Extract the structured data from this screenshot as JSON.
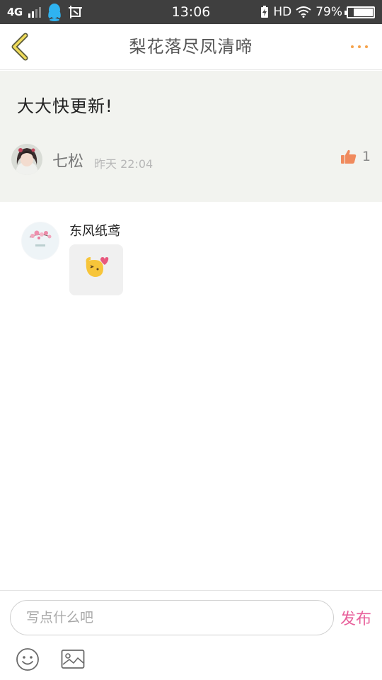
{
  "status_bar": {
    "network": "4G",
    "time": "13:06",
    "hd": "HD",
    "battery": "79%",
    "battery_level": 0.79
  },
  "nav": {
    "title": "梨花落尽凤清啼"
  },
  "post": {
    "text": "大大快更新!",
    "author": "七松",
    "time": "昨天 22:04",
    "likes": "1"
  },
  "reply": {
    "author": "东风纸鸢"
  },
  "composer": {
    "placeholder": "写点什么吧",
    "publish_label": "发布"
  },
  "colors": {
    "accent_orange": "#f5a24a",
    "publish_pink": "#e8609b",
    "post_background": "#f2f3ef",
    "status_bar": "#3f3f3f"
  },
  "icons": [
    "back-arrow-icon",
    "more-dots-icon",
    "qq-icon",
    "screenshot-icon",
    "charging-icon",
    "wifi-icon",
    "thumbs-up-icon",
    "emoji-icon",
    "image-icon"
  ]
}
